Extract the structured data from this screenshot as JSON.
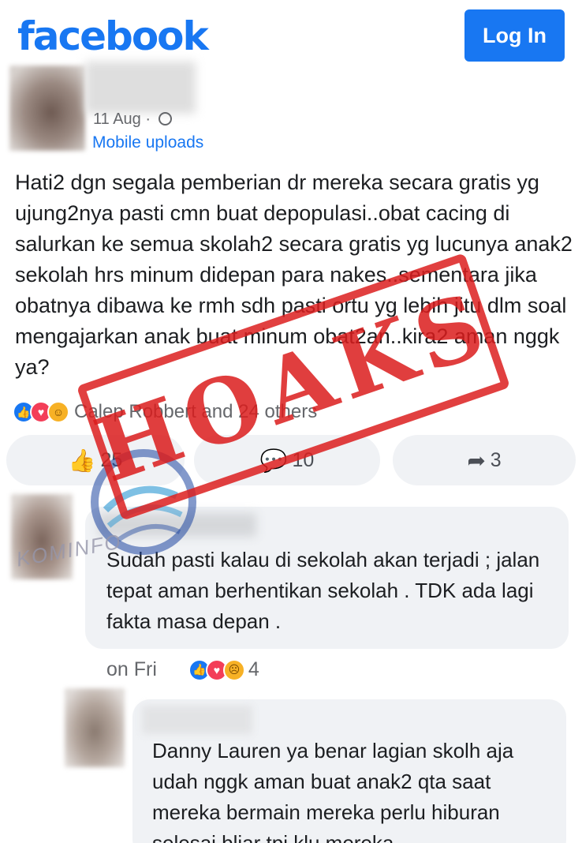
{
  "header": {
    "logo_text": "facebook",
    "login_label": "Log In",
    "brand_color": "#1877f2"
  },
  "post": {
    "date": "11 Aug",
    "privacy_icon": "globe-icon",
    "source": "Mobile uploads",
    "text": "Hati2 dgn segala pemberian dr mereka secara gratis yg ujung2nya pasti cmn buat depopulasi..obat cacing di salurkan ke semua skolah2 secara gratis yg lucunya anak2 sekolah hrs minum didepan para nakes..sementara jika obatnya dibawa ke rmh sdh pasti ortu yg lebih jitu dlm soal mengajarkan anak buat minum obat2an..kira2 aman nggk ya?",
    "reactions_text": "Calep Robbert and 24 others",
    "like_count": "25",
    "comment_count": "10",
    "share_count": "3"
  },
  "comments": [
    {
      "text": "Sudah pasti kalau di sekolah akan terjadi ; jalan tepat aman berhentikan sekolah . TDK ada lagi fakta masa depan .",
      "time": "on Fri",
      "reaction_count": "4"
    },
    {
      "text": "Danny Lauren ya benar lagian skolh aja udah nggk aman buat anak2 qta saat mereka bermain mereka perlu hiburan selesai bljar tpi klu mereka"
    }
  ],
  "overlay": {
    "stamp_text": "HOAKS",
    "stamp_color": "#dc1e1e",
    "watermark_text": "KOMINFO"
  }
}
